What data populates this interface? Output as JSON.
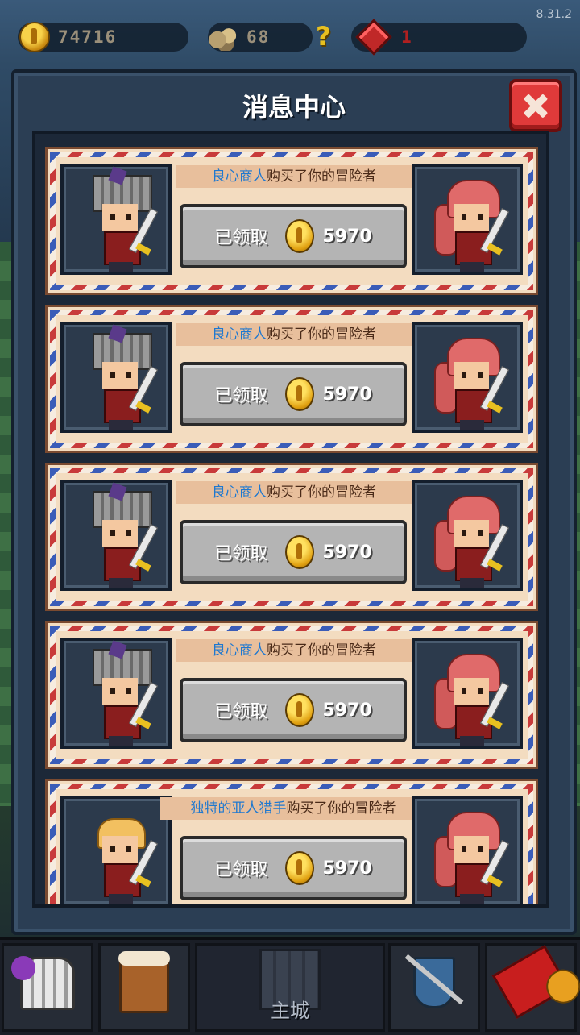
{
  "version": "8.31.2",
  "resources": {
    "gold": "74716",
    "ore": "68",
    "unknown": "?",
    "gems": "1"
  },
  "modal": {
    "title": "消息中心"
  },
  "messages": [
    {
      "buyer": "良心商人",
      "text": "购买了你的冒险者",
      "button": "已领取",
      "amount": "5970",
      "left_portrait": "helmet-knight-icon",
      "right_portrait": "pink-hair-swordswoman-icon"
    },
    {
      "buyer": "良心商人",
      "text": "购买了你的冒险者",
      "button": "已领取",
      "amount": "5970",
      "left_portrait": "helmet-knight-icon",
      "right_portrait": "pink-hair-swordswoman-icon"
    },
    {
      "buyer": "良心商人",
      "text": "购买了你的冒险者",
      "button": "已领取",
      "amount": "5970",
      "left_portrait": "helmet-knight-icon",
      "right_portrait": "pink-hair-swordswoman-icon"
    },
    {
      "buyer": "良心商人",
      "text": "购买了你的冒险者",
      "button": "已领取",
      "amount": "5970",
      "left_portrait": "helmet-knight-icon",
      "right_portrait": "pink-hair-swordswoman-icon"
    },
    {
      "buyer": "独特的亚人猎手",
      "text": "购买了你的冒险者",
      "button": "已领取",
      "amount": "5970",
      "left_portrait": "blond-swordsman-icon",
      "right_portrait": "pink-hair-swordswoman-icon"
    }
  ],
  "bottom_nav": {
    "items": [
      {
        "icon": "helmet-icon"
      },
      {
        "icon": "tavern-mug-icon"
      },
      {
        "icon": "castle-icon",
        "label": "主城"
      },
      {
        "icon": "shield-swords-icon"
      },
      {
        "icon": "red-envelope-coin-icon"
      }
    ]
  },
  "colors": {
    "buyer_name": "#1e78d0",
    "close_button": "#e03a3a",
    "gem_value": "#b02020"
  }
}
